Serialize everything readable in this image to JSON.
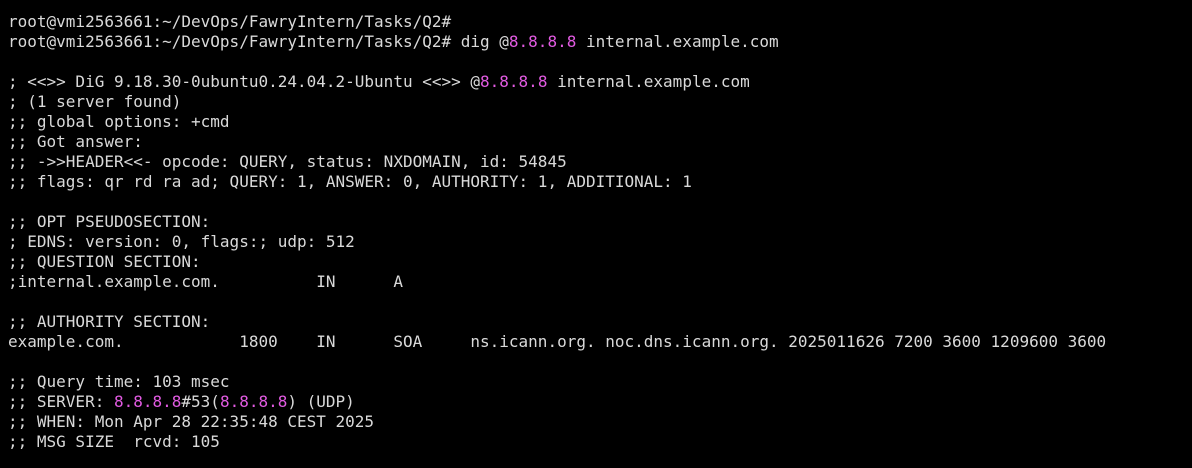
{
  "terminal": {
    "prompt": "root@vmi2563661:~/DevOps/FawryIntern/Tasks/Q2#",
    "command_dig": " dig @",
    "command_ip": "8.8.8.8",
    "command_rest": " internal.example.com",
    "dig_banner_pre": "; <<>> DiG 9.18.30-0ubuntu0.24.04.2-Ubuntu <<>> @",
    "dig_banner_ip": "8.8.8.8",
    "dig_banner_post": " internal.example.com",
    "servers_found": "; (1 server found)",
    "global_options": ";; global options: +cmd",
    "got_answer": ";; Got answer:",
    "header_line": ";; ->>HEADER<<- opcode: QUERY, status: NXDOMAIN, id: 54845",
    "flags_line": ";; flags: qr rd ra ad; QUERY: 1, ANSWER: 0, AUTHORITY: 1, ADDITIONAL: 1",
    "opt_section": ";; OPT PSEUDOSECTION:",
    "edns_line": "; EDNS: version: 0, flags:; udp: 512",
    "question_section": ";; QUESTION SECTION:",
    "question_record": ";internal.example.com.          IN      A",
    "authority_section": ";; AUTHORITY SECTION:",
    "authority_record": "example.com.            1800    IN      SOA     ns.icann.org. noc.dns.icann.org. 2025011626 7200 3600 1209600 3600",
    "query_time": ";; Query time: 103 msec",
    "server_pre": ";; SERVER: ",
    "server_ip": "8.8.8.8",
    "server_mid": "#53(",
    "server_ip2": "8.8.8.8",
    "server_post": ") (UDP)",
    "when_line": ";; WHEN: Mon Apr 28 22:35:48 CEST 2025",
    "msg_size": ";; MSG SIZE  rcvd: 105"
  },
  "colors": {
    "background": "#000000",
    "text": "#d9d9d9",
    "ip_highlight": "#e25be2"
  }
}
